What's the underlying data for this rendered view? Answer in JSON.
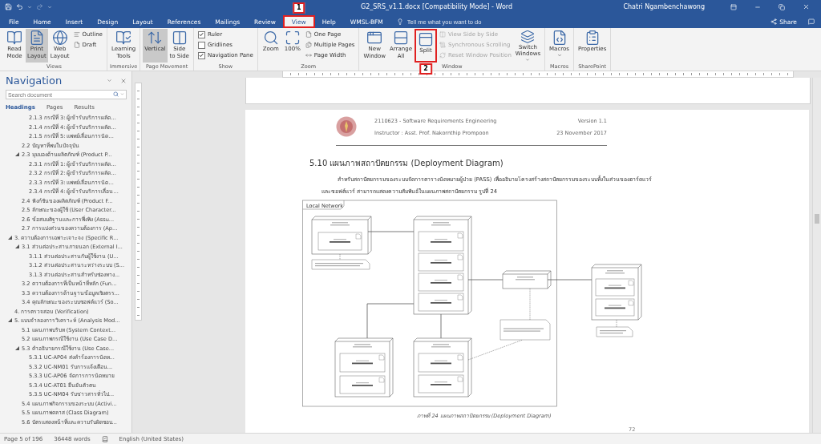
{
  "title_bar": {
    "document_title": "G2_SRS_v1.1.docx [Compatibility Mode]  -  Word",
    "user": "Chatri Ngambenchawong"
  },
  "ribbon_tabs": [
    {
      "label": "File",
      "selected": false
    },
    {
      "label": "Home",
      "selected": false
    },
    {
      "label": "Insert",
      "selected": false
    },
    {
      "label": "Design",
      "selected": false
    },
    {
      "label": "Layout",
      "selected": false
    },
    {
      "label": "References",
      "selected": false
    },
    {
      "label": "Mailings",
      "selected": false
    },
    {
      "label": "Review",
      "selected": false
    },
    {
      "label": "View",
      "selected": true,
      "callout": "1"
    },
    {
      "label": "Help",
      "selected": false
    },
    {
      "label": "WMSL-BFM",
      "selected": false
    }
  ],
  "tell_me": {
    "placeholder": "Tell me what you want to do"
  },
  "share": "Share",
  "ribbon_groups": [
    {
      "label": "Views",
      "items": [
        {
          "kind": "large",
          "label": "Read\nMode",
          "selected": false
        },
        {
          "kind": "large",
          "label": "Print\nLayout",
          "selected": true
        },
        {
          "kind": "large",
          "label": "Web\nLayout",
          "selected": false
        },
        {
          "kind": "small",
          "label": "Outline",
          "disabled": false
        },
        {
          "kind": "small",
          "label": "Draft",
          "disabled": false
        }
      ]
    },
    {
      "label": "Immersive",
      "items": [
        {
          "kind": "large",
          "label": "Learning\nTools",
          "selected": false
        }
      ]
    },
    {
      "label": "Page Movement",
      "items": [
        {
          "kind": "large",
          "label": "Vertical",
          "selected": true
        },
        {
          "kind": "large",
          "label": "Side\nto Side",
          "selected": false
        }
      ]
    },
    {
      "label": "Show",
      "items": [
        {
          "kind": "check",
          "label": "Ruler",
          "checked": true
        },
        {
          "kind": "check",
          "label": "Gridlines",
          "checked": false
        },
        {
          "kind": "check",
          "label": "Navigation Pane",
          "checked": true
        }
      ]
    },
    {
      "label": "Zoom",
      "items": [
        {
          "kind": "large",
          "label": "Zoom",
          "selected": false
        },
        {
          "kind": "large",
          "label": "100%",
          "selected": false
        },
        {
          "kind": "small",
          "label": "One Page",
          "disabled": false
        },
        {
          "kind": "small",
          "label": "Multiple Pages",
          "disabled": false
        },
        {
          "kind": "small",
          "label": "Page Width",
          "disabled": false
        }
      ]
    },
    {
      "label": "Window",
      "items": [
        {
          "kind": "large",
          "label": "New\nWindow",
          "selected": false
        },
        {
          "kind": "large",
          "label": "Arrange\nAll",
          "selected": false
        },
        {
          "kind": "large",
          "label": "Split",
          "selected": false,
          "callout": "2"
        },
        {
          "kind": "small",
          "label": "View Side by Side",
          "disabled": true
        },
        {
          "kind": "small",
          "label": "Synchronous Scrolling",
          "disabled": true
        },
        {
          "kind": "small",
          "label": "Reset Window Position",
          "disabled": true
        },
        {
          "kind": "large",
          "label": "Switch\nWindows",
          "selected": false,
          "dropdown": true
        }
      ]
    },
    {
      "label": "Macros",
      "items": [
        {
          "kind": "large",
          "label": "Macros",
          "selected": false,
          "dropdown": true
        }
      ]
    },
    {
      "label": "SharePoint",
      "items": [
        {
          "kind": "large",
          "label": "Properties",
          "selected": false
        }
      ]
    }
  ],
  "navigation": {
    "title": "Navigation",
    "search": {
      "placeholder": "Search document"
    },
    "tabs": [
      {
        "label": "Headings",
        "selected": true
      },
      {
        "label": "Pages",
        "selected": false
      },
      {
        "label": "Results",
        "selected": false
      }
    ],
    "headings": [
      {
        "children": [
          {
            "children": [
              {
                "label": "2.1.3 กรณีที่ 3: ผู้เข้ารับบริการผลัด..."
              },
              {
                "label": "2.1.4 กรณีที่ 4: ผู้เข้ารับบริการผลัด..."
              },
              {
                "label": "2.1.5 กรณีที่ 5: แพทย์เลื่อนการนัด..."
              }
            ]
          },
          {
            "label": "2.2 ปัญหาที่พบในปัจจุบัน"
          },
          {
            "label": "2.3 มุมมองด้านผลิตภัณฑ์ (Product P...",
            "expanded": true,
            "children": [
              {
                "label": "2.3.1 กรณีที่ 1: ผู้เข้ารับบริการผลัด..."
              },
              {
                "label": "2.3.2 กรณีที่ 2: ผู้เข้ารับบริการผลัด..."
              },
              {
                "label": "2.3.3 กรณีที่ 3: แพทย์เลื่อนการนัด..."
              },
              {
                "label": "2.3.4 กรณีที่ 4: ผู้เข้ารับบริการเลื่อน..."
              }
            ]
          },
          {
            "label": "2.4 ฟังก์ชันของผลิตภัณฑ์ (Product F..."
          },
          {
            "label": "2.5 ลักษณะของผู้ใช้ (User Character..."
          },
          {
            "label": "2.6 ข้อสมมติฐานและการพึ่งพิง (Assu..."
          },
          {
            "label": "2.7 การแบ่งส่วนของความต้องการ (Ap..."
          }
        ]
      },
      {
        "label": "3. ความต้องการเฉพาะเจาะจง (Specific R...",
        "expanded": true,
        "children": [
          {
            "label": "3.1 ส่วนต่อประสานภายนอก (External I...",
            "expanded": true,
            "children": [
              {
                "label": "3.1.1 ส่วนต่อประสานกับผู้ใช้งาน (U..."
              },
              {
                "label": "3.1.2 ส่วนต่อประสานระหว่างระบบ (S..."
              },
              {
                "label": "3.1.3 ส่วนต่อประสานสำหรับช่องทาง..."
              }
            ]
          },
          {
            "label": "3.2 ความต้องการที่เป็นหน้าที่หลัก (Fun..."
          },
          {
            "label": "3.3 ความต้องการด้านฐานข้อมูลเชิงตรร..."
          },
          {
            "label": "3.4 คุณลักษณะของระบบซอฟต์แวร์ (So..."
          }
        ]
      },
      {
        "label": "4. การตรวจสอบ (Verification)"
      },
      {
        "label": "5. แบบจำลองการวิเคราะห์ (Analysis Mod...",
        "expanded": true,
        "children": [
          {
            "label": "5.1 แผนภาพบริบท (System Context..."
          },
          {
            "label": "5.2 แผนภาพกรณีใช้งาน (Use Case D..."
          },
          {
            "label": "5.3 คำอธิบายกรณีใช้งาน (Use Case...",
            "expanded": true,
            "children": [
              {
                "label": "5.3.1 UC-AP04 ส่งคำร้องการนัดห..."
              },
              {
                "label": "5.3.2 UC-NM01 รับการแจ้งเตือน..."
              },
              {
                "label": "5.3.3 UC-AP06 จัดการการนัดหมาย"
              },
              {
                "label": "5.3.4 UC-AT01 ยืนยันตัวตน"
              },
              {
                "label": "5.3.5 UC-NM04 รับข่าวสารทั่วไป..."
              }
            ]
          },
          {
            "label": "5.4 แผนภาพกิจกรรมของระบบ (Activi..."
          },
          {
            "label": "5.5 แผนภาพคลาส (Class Diagram)"
          },
          {
            "label": "5.6 บัตรแสดงหน้าที่และความรับผิดชอบ..."
          }
        ]
      }
    ]
  },
  "document": {
    "header": {
      "course": "2110623 - Software Requirements Engineering",
      "version": "Version 1.1",
      "instructor": "Instructor : Asst. Prof. Nakornthip Prompoon",
      "date": "23 November 2017"
    },
    "heading": "5.10  แผนภาพสถาปัตยกรรม (Deployment Diagram)",
    "paragraph": "สำหรับสถาปัตยกรรมของระบบจัดการตารางนัดหมายผู้ป่วย (PASS) เพื่ออธิบายโครงสร้างสถาปัตยกรรมของระบบทั้งในส่วนของฮาร์ดแวร์ และซอฟต์แวร์ สามารถแสดงความสัมพันธ์ในแผนภาพสถาปัตยกรรม รูปที่ 24",
    "figure": {
      "frame_label": "Local Network",
      "caption": "ภาพที่ 24 แผนภาพสถาปัตยกรรม (Deployment Diagram)"
    },
    "page_number": "72"
  },
  "status_bar": {
    "page": "Page 5 of 196",
    "words": "36448 words",
    "language": "English (United States)"
  }
}
